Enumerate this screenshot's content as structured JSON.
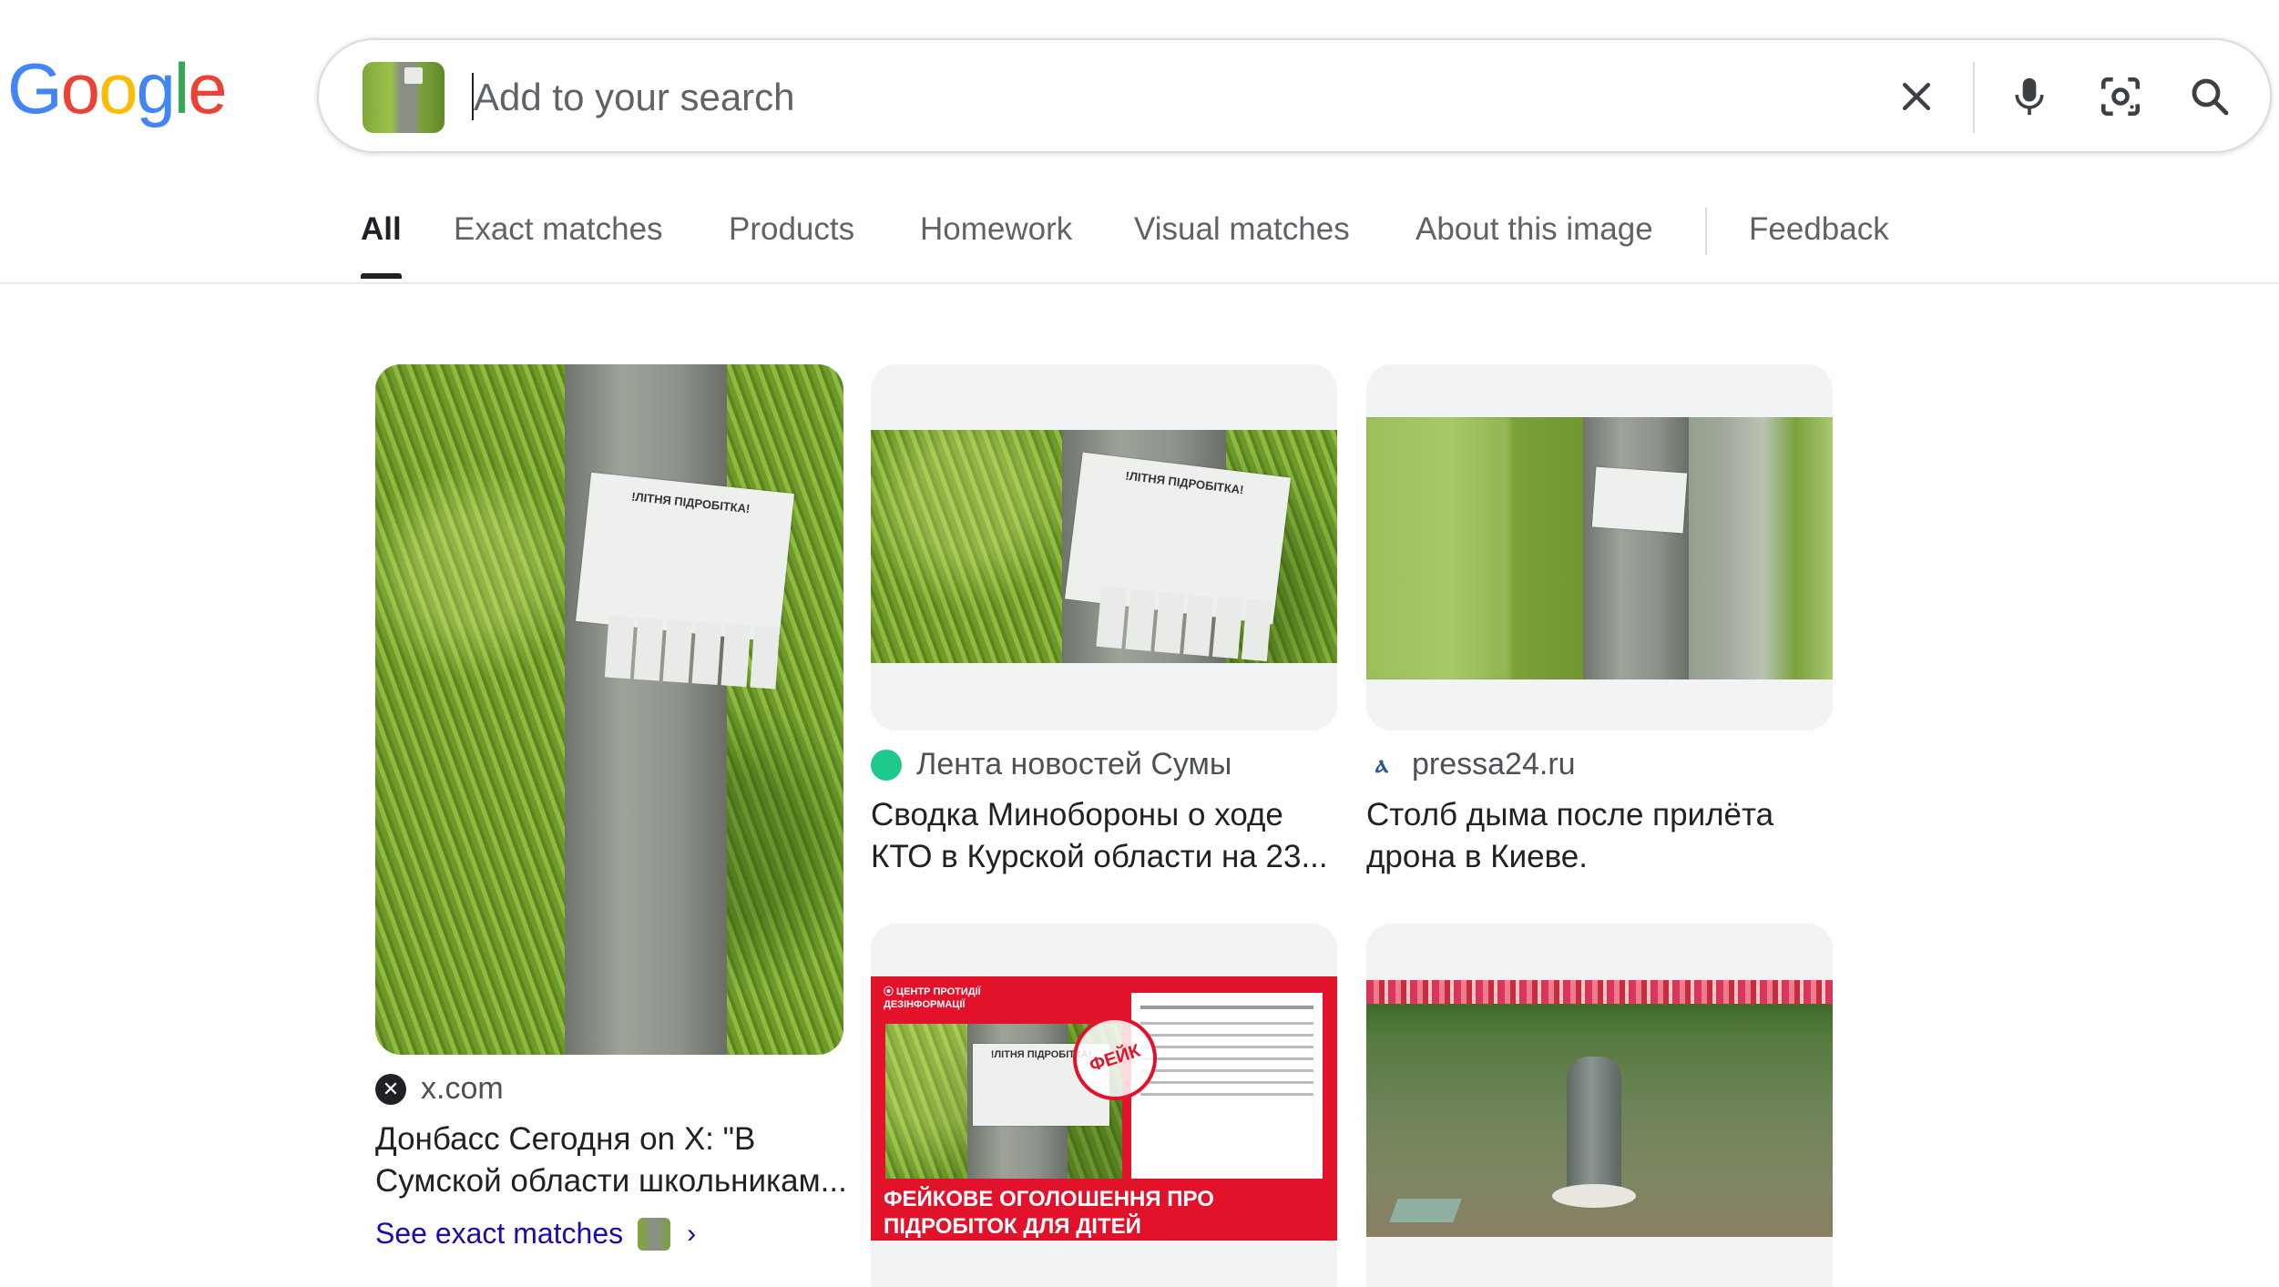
{
  "logo": {
    "text": "Google",
    "letters": [
      {
        "ch": "G",
        "color": "#4285F4"
      },
      {
        "ch": "o",
        "color": "#EA4335"
      },
      {
        "ch": "o",
        "color": "#FBBC05"
      },
      {
        "ch": "g",
        "color": "#4285F4"
      },
      {
        "ch": "l",
        "color": "#34A853"
      },
      {
        "ch": "e",
        "color": "#EA4335"
      }
    ]
  },
  "search": {
    "placeholder": "Add to your search",
    "value": ""
  },
  "icons": {
    "clear": "close-icon",
    "voice": "microphone-icon",
    "lens": "camera-lens-icon",
    "search": "search-icon"
  },
  "tabs": [
    {
      "label": "All",
      "active": true
    },
    {
      "label": "Exact matches"
    },
    {
      "label": "Products"
    },
    {
      "label": "Homework"
    },
    {
      "label": "Visual matches"
    },
    {
      "label": "About this image"
    },
    {
      "label": "Feedback"
    }
  ],
  "results": [
    {
      "source": "x.com",
      "title": "Донбасс Сегодня on X: \"В Сумской области школьникам...",
      "poster_heading": "!ЛІТНЯ ПІДРОБІТКА!"
    },
    {
      "source": "Лента новостей Сумы",
      "title": "Сводка Минобороны о ходе КТО в Курской области на 23...",
      "poster_heading": "!ЛІТНЯ ПІДРОБІТКА!"
    },
    {
      "source": "pressa24.ru",
      "title": "Столб дыма после прилёта дрона в Киеве."
    },
    {
      "banner": "ФЕЙКОВЕ ОГОЛОШЕННЯ ПРО ПІДРОБІТОК ДЛЯ ДІТЕЙ",
      "stamp": "ФЕЙК"
    },
    {}
  ],
  "see_exact": {
    "label": "See exact matches"
  },
  "colors": {
    "link": "#1a0dab",
    "text": "#202124",
    "muted": "#5f6368",
    "lenta_favicon": "#1ec98b",
    "fake_red": "#e3122b"
  }
}
